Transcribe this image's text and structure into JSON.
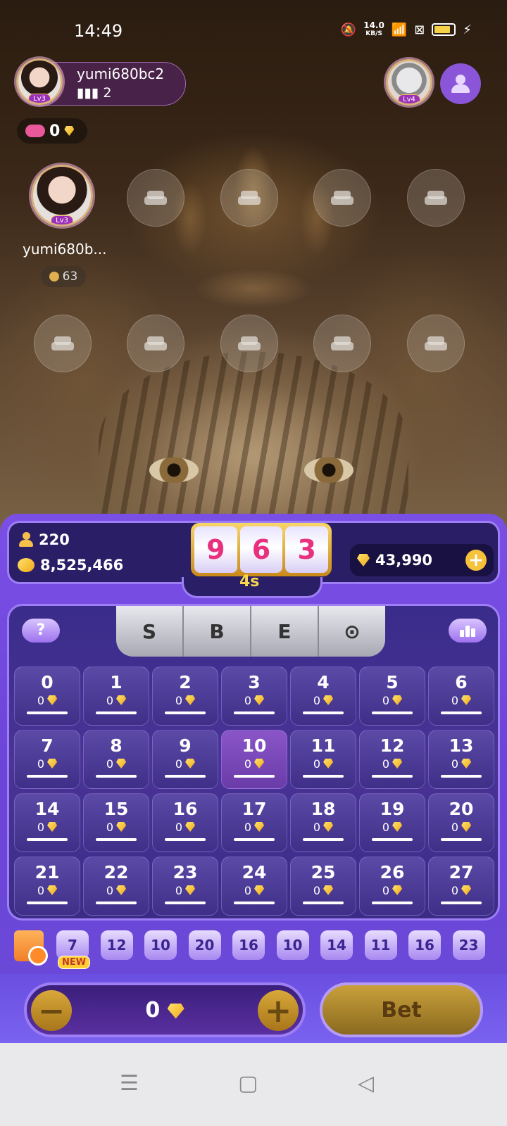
{
  "status": {
    "time": "14:49",
    "net_speed": "14.0",
    "net_unit": "KB/S"
  },
  "host": {
    "name": "yumi680bc2",
    "listeners": "2",
    "level": "Lv3"
  },
  "game_counter": {
    "value": "0"
  },
  "top_right": {
    "level": "Lv4"
  },
  "seat_user": {
    "name": "yumi680b...",
    "level": "Lv3",
    "score": "63"
  },
  "panel": {
    "players": "220",
    "coins": "8,525,466",
    "diamonds": "43,990",
    "timer": "4s",
    "reels": [
      "9",
      "6",
      "3"
    ]
  },
  "tabs": [
    "S",
    "B",
    "E",
    "⊙"
  ],
  "help_label": "?",
  "cells": [
    {
      "num": "0",
      "bet": "0"
    },
    {
      "num": "1",
      "bet": "0"
    },
    {
      "num": "2",
      "bet": "0"
    },
    {
      "num": "3",
      "bet": "0"
    },
    {
      "num": "4",
      "bet": "0"
    },
    {
      "num": "5",
      "bet": "0"
    },
    {
      "num": "6",
      "bet": "0"
    },
    {
      "num": "7",
      "bet": "0"
    },
    {
      "num": "8",
      "bet": "0"
    },
    {
      "num": "9",
      "bet": "0"
    },
    {
      "num": "10",
      "bet": "0"
    },
    {
      "num": "11",
      "bet": "0"
    },
    {
      "num": "12",
      "bet": "0"
    },
    {
      "num": "13",
      "bet": "0"
    },
    {
      "num": "14",
      "bet": "0"
    },
    {
      "num": "15",
      "bet": "0"
    },
    {
      "num": "16",
      "bet": "0"
    },
    {
      "num": "17",
      "bet": "0"
    },
    {
      "num": "18",
      "bet": "0"
    },
    {
      "num": "19",
      "bet": "0"
    },
    {
      "num": "20",
      "bet": "0"
    },
    {
      "num": "21",
      "bet": "0"
    },
    {
      "num": "22",
      "bet": "0"
    },
    {
      "num": "23",
      "bet": "0"
    },
    {
      "num": "24",
      "bet": "0"
    },
    {
      "num": "25",
      "bet": "0"
    },
    {
      "num": "26",
      "bet": "0"
    },
    {
      "num": "27",
      "bet": "0"
    }
  ],
  "history": [
    "7",
    "12",
    "10",
    "20",
    "16",
    "10",
    "14",
    "11",
    "16",
    "23"
  ],
  "new_label": "NEW",
  "bet_amount": "0",
  "bet_label": "Bet",
  "nav": {
    "menu": "☰",
    "home": "▢",
    "back": "◁"
  },
  "colors": {
    "accent": "#7a4fe6",
    "gold": "#f5c23a",
    "reel_digit": "#e8307e"
  }
}
